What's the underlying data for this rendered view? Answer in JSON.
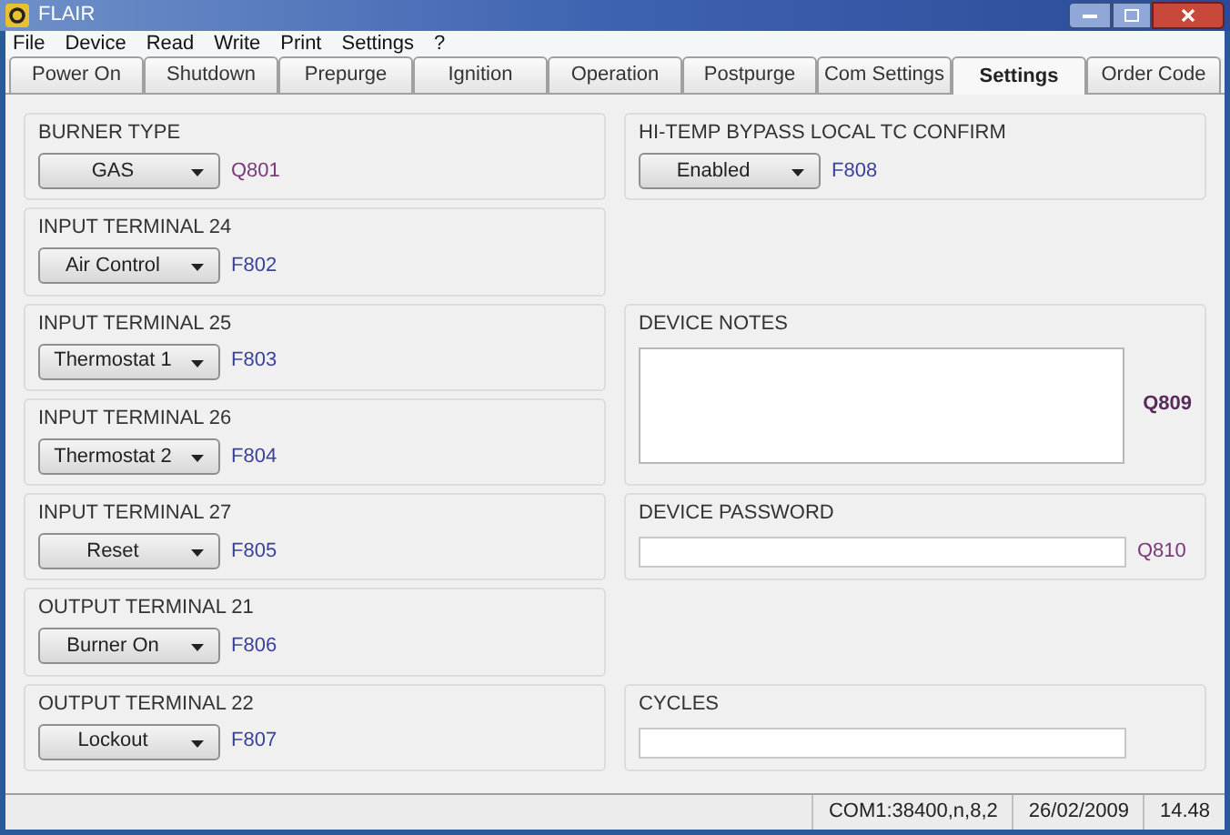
{
  "window": {
    "title": "FLAIR"
  },
  "menu": [
    "File",
    "Device",
    "Read",
    "Write",
    "Print",
    "Settings",
    "?"
  ],
  "tabs": [
    {
      "label": "Power On",
      "selected": false
    },
    {
      "label": "Shutdown",
      "selected": false
    },
    {
      "label": "Prepurge",
      "selected": false
    },
    {
      "label": "Ignition",
      "selected": false
    },
    {
      "label": "Operation",
      "selected": false
    },
    {
      "label": "Postpurge",
      "selected": false
    },
    {
      "label": "Com Settings",
      "selected": false
    },
    {
      "label": "Settings",
      "selected": true
    },
    {
      "label": "Order Code",
      "selected": false
    }
  ],
  "left_groups": [
    {
      "title": "BURNER TYPE",
      "value": "GAS",
      "code": "Q801",
      "color": "#7a3a78"
    },
    {
      "title": "INPUT TERMINAL 24",
      "value": "Air Control",
      "code": "F802",
      "color": "#3b3f9e"
    },
    {
      "title": "INPUT TERMINAL 25",
      "value": "Thermostat 1",
      "code": "F803",
      "color": "#3b3f9e"
    },
    {
      "title": "INPUT TERMINAL 26",
      "value": "Thermostat 2",
      "code": "F804",
      "color": "#3b3f9e"
    },
    {
      "title": "INPUT TERMINAL 27",
      "value": "Reset",
      "code": "F805",
      "color": "#3b3f9e"
    },
    {
      "title": "OUTPUT TERMINAL 21",
      "value": "Burner On",
      "code": "F806",
      "color": "#3b3f9e"
    },
    {
      "title": "OUTPUT TERMINAL 22",
      "value": "Lockout",
      "code": "F807",
      "color": "#3b3f9e"
    }
  ],
  "right_groups": [
    {
      "kind": "dropdown",
      "title": "HI-TEMP BYPASS LOCAL TC CONFIRM",
      "value": "Enabled",
      "code": "F808",
      "color": "#3b3f9e"
    },
    {
      "kind": "notes",
      "title": "DEVICE NOTES",
      "code": "Q809",
      "color": "#5a2a5a"
    },
    {
      "kind": "textbox",
      "title": "DEVICE PASSWORD",
      "code": "Q810",
      "color": "#7a3a78"
    },
    {
      "kind": "textbox",
      "title": "CYCLES"
    }
  ],
  "status_bar": [
    "COM1:38400,n,8,2",
    "26/02/2009",
    "14.48"
  ]
}
